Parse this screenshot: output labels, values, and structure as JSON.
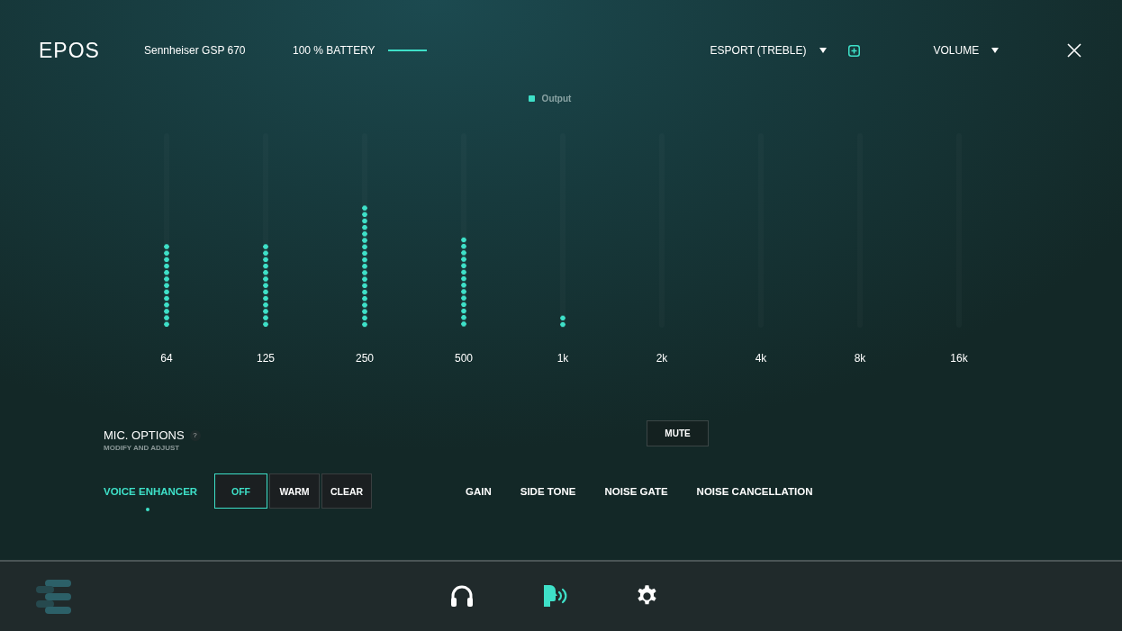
{
  "header": {
    "logo": "EPOS",
    "device": "Sennheiser GSP 670",
    "battery": {
      "label": "100 % BATTERY",
      "level": 1
    },
    "preset": "ESPORT (TREBLE)",
    "mode": "VOLUME"
  },
  "equalizer": {
    "legend": "Output",
    "bands": [
      {
        "label": "64",
        "level": 0.43
      },
      {
        "label": "125",
        "level": 0.43
      },
      {
        "label": "250",
        "level": 0.63
      },
      {
        "label": "500",
        "level": 0.47
      },
      {
        "label": "1k",
        "level": 0.07
      },
      {
        "label": "2k"
      },
      {
        "label": "4k"
      },
      {
        "label": "8k"
      },
      {
        "label": "16k"
      }
    ]
  },
  "mic_options": {
    "title": "MIC. OPTIONS",
    "help": "?",
    "subtitle": "MODIFY AND ADJUST",
    "mute_button": "MUTE",
    "tabs": [
      {
        "label": "VOICE ENHANCER",
        "selected": true
      },
      {
        "label": "GAIN",
        "selected": false
      },
      {
        "label": "SIDE TONE",
        "selected": false
      },
      {
        "label": "NOISE GATE",
        "selected": false
      },
      {
        "label": "NOISE CANCELLATION",
        "selected": false
      }
    ],
    "enhancer_modes": [
      {
        "label": "OFF",
        "selected": true
      },
      {
        "label": "WARM",
        "selected": false
      },
      {
        "label": "CLEAR",
        "selected": false
      }
    ]
  },
  "bottom_nav": [
    {
      "kind": "headphones",
      "selected": false
    },
    {
      "kind": "microphone",
      "selected": true
    },
    {
      "kind": "settings",
      "selected": false
    }
  ]
}
